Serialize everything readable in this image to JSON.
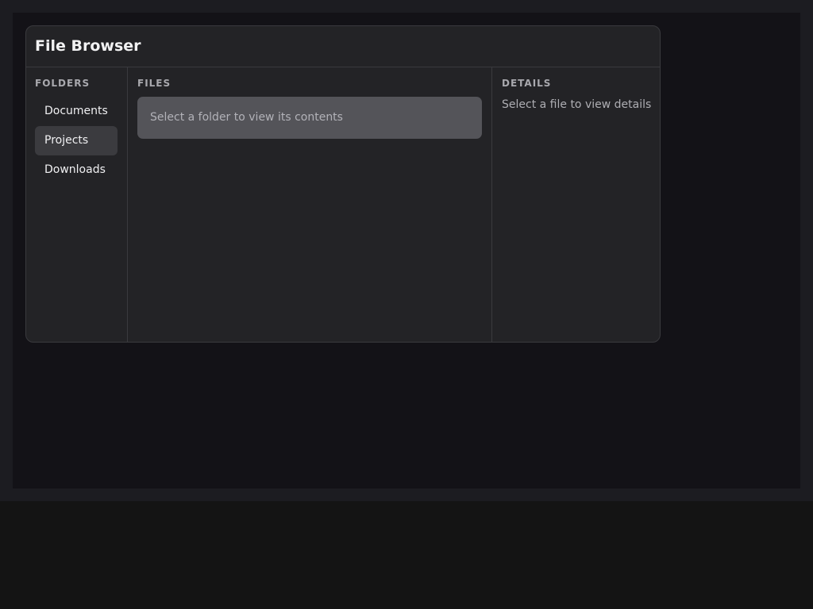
{
  "app": {
    "title": "File Browser"
  },
  "folders": {
    "label": "FOLDERS",
    "items": [
      {
        "label": "Documents",
        "active": false
      },
      {
        "label": "Projects",
        "active": true
      },
      {
        "label": "Downloads",
        "active": false
      }
    ]
  },
  "files": {
    "label": "FILES",
    "empty_message": "Select a folder to view its contents"
  },
  "details": {
    "label": "DETAILS",
    "empty_message": "Select a file to view details"
  },
  "colors": {
    "background": "#131217",
    "panel": "#232326",
    "active_item": "#3b3b3f",
    "empty_box": "#545459"
  }
}
